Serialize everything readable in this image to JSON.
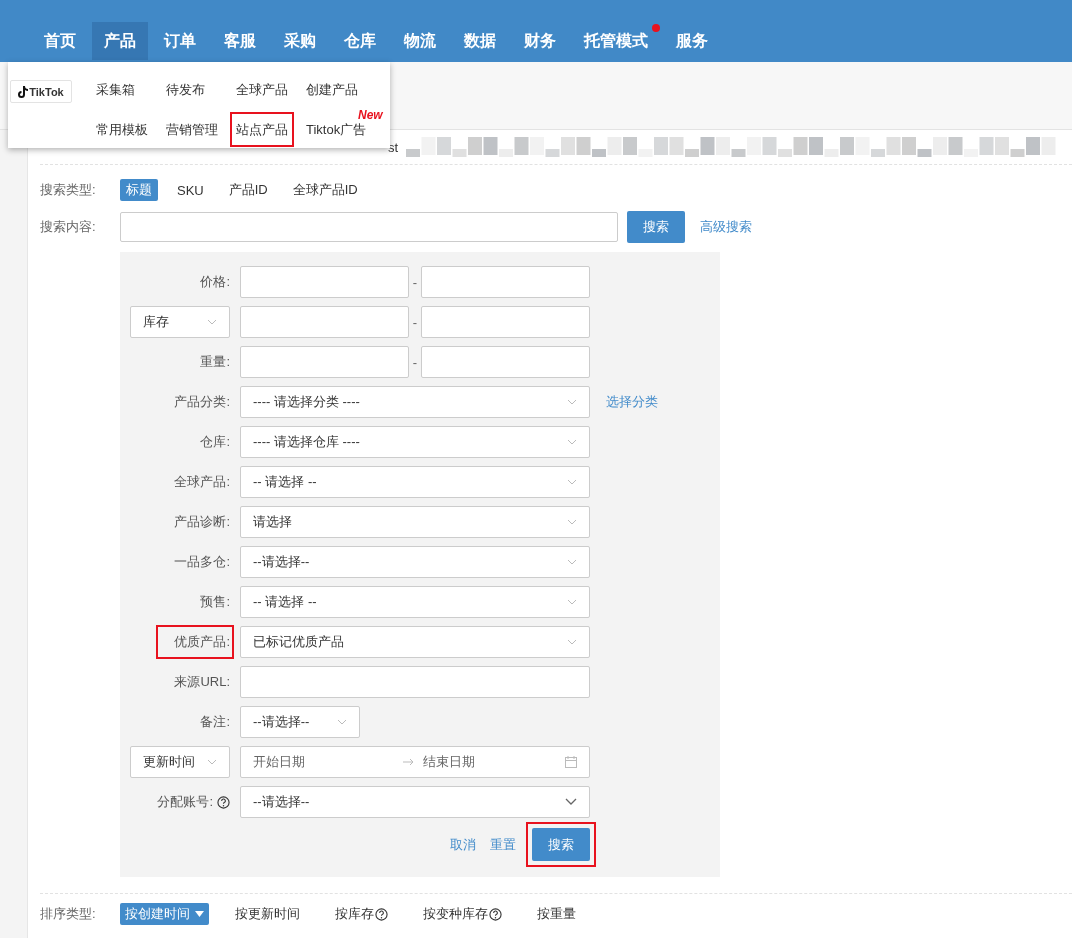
{
  "nav": [
    {
      "label": "首页",
      "selected": false,
      "badge": false
    },
    {
      "label": "产品",
      "selected": true,
      "badge": false
    },
    {
      "label": "订单",
      "selected": false,
      "badge": false
    },
    {
      "label": "客服",
      "selected": false,
      "badge": false
    },
    {
      "label": "采购",
      "selected": false,
      "badge": false
    },
    {
      "label": "仓库",
      "selected": false,
      "badge": false
    },
    {
      "label": "物流",
      "selected": false,
      "badge": false
    },
    {
      "label": "数据",
      "selected": false,
      "badge": false
    },
    {
      "label": "财务",
      "selected": false,
      "badge": false
    },
    {
      "label": "托管模式",
      "selected": false,
      "badge": true
    },
    {
      "label": "服务",
      "selected": false,
      "badge": false
    }
  ],
  "menu": {
    "logo_text": "TikTok",
    "items": [
      {
        "label": "采集箱",
        "highlighted": false
      },
      {
        "label": "待发布",
        "highlighted": false
      },
      {
        "label": "全球产品",
        "highlighted": false
      },
      {
        "label": "创建产品",
        "highlighted": false
      },
      {
        "label": "常用模板",
        "highlighted": false
      },
      {
        "label": "营销管理",
        "highlighted": false
      },
      {
        "label": "站点产品",
        "highlighted": true
      },
      {
        "label": "Tiktok广告",
        "highlighted": false,
        "tag": "New"
      }
    ]
  },
  "filter_row": {
    "partial_text": "st"
  },
  "search_type": {
    "label": "搜索类型:",
    "options": [
      {
        "label": "标题",
        "selected": true
      },
      {
        "label": "SKU",
        "selected": false
      },
      {
        "label": "产品ID",
        "selected": false
      },
      {
        "label": "全球产品ID",
        "selected": false
      }
    ]
  },
  "search_content": {
    "label": "搜索内容:",
    "button": "搜索",
    "advanced_link": "高级搜索"
  },
  "advanced": {
    "rows": [
      {
        "kind": "range",
        "label": "价格:",
        "separator": "-"
      },
      {
        "kind": "range",
        "label_dropdown": "库存",
        "separator": "-"
      },
      {
        "kind": "range",
        "label": "重量:",
        "separator": "-"
      },
      {
        "kind": "select",
        "label": "产品分类:",
        "value": "---- 请选择分类 ----",
        "link": "选择分类"
      },
      {
        "kind": "select",
        "label": "仓库:",
        "value": "---- 请选择仓库 ----"
      },
      {
        "kind": "select",
        "label": "全球产品:",
        "value": "-- 请选择 --"
      },
      {
        "kind": "select",
        "label": "产品诊断:",
        "value": "请选择"
      },
      {
        "kind": "select",
        "label": "一品多仓:",
        "value": "--请选择--"
      },
      {
        "kind": "select",
        "label": "预售:",
        "value": "-- 请选择 --"
      },
      {
        "kind": "select",
        "label": "优质产品:",
        "value": "已标记优质产品",
        "label_highlighted": true
      },
      {
        "kind": "text",
        "label": "来源URL:"
      },
      {
        "kind": "small_select",
        "label": "备注:",
        "value": "--请选择--"
      },
      {
        "kind": "date",
        "label_dropdown": "更新时间",
        "start_placeholder": "开始日期",
        "end_placeholder": "结束日期"
      },
      {
        "kind": "select",
        "label": "分配账号:",
        "value": "--请选择--",
        "help": true,
        "large_caret": true
      }
    ],
    "cancel": "取消",
    "reset": "重置",
    "search": "搜索",
    "search_highlighted": true
  },
  "sort": {
    "label": "排序类型:",
    "options": [
      {
        "label": "按创建时间",
        "selected": true,
        "help": false
      },
      {
        "label": "按更新时间",
        "selected": false,
        "help": false
      },
      {
        "label": "按库存",
        "selected": false,
        "help": true
      },
      {
        "label": "按变种库存",
        "selected": false,
        "help": true
      },
      {
        "label": "按重量",
        "selected": false,
        "help": false
      }
    ]
  }
}
